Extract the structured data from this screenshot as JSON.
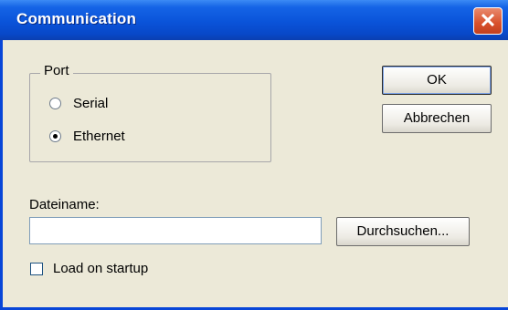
{
  "window": {
    "title": "Communication",
    "close_icon": "close-icon"
  },
  "port_group": {
    "label": "Port",
    "options": [
      {
        "label": "Serial",
        "checked": false
      },
      {
        "label": "Ethernet",
        "checked": true
      }
    ]
  },
  "buttons": {
    "ok": "OK",
    "cancel": "Abbrechen",
    "browse": "Durchsuchen..."
  },
  "file": {
    "label": "Dateiname:",
    "value": ""
  },
  "load_on_startup": {
    "label": "Load on startup",
    "checked": false
  },
  "colors": {
    "titlebar": "#0A53D9",
    "face": "#ECE9D8",
    "close": "#D8502B"
  }
}
